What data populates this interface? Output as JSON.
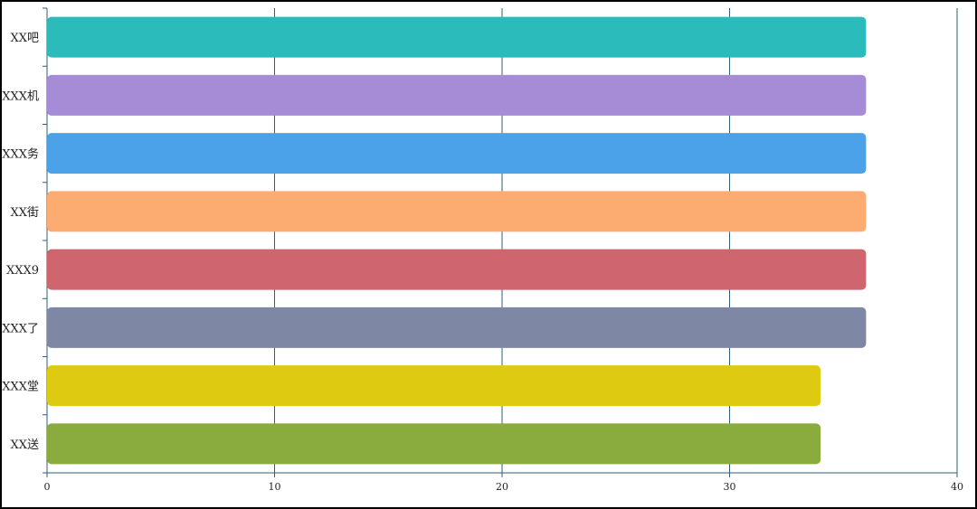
{
  "chart_data": {
    "type": "bar",
    "orientation": "horizontal",
    "categories": [
      "XX吧",
      "XXX机",
      "XXX务",
      "XX街",
      "XXX9",
      "XXX了",
      "XXX堂",
      "XX送"
    ],
    "values": [
      36,
      36,
      36,
      36,
      36,
      36,
      34,
      34
    ],
    "colors": [
      "#2bbbbb",
      "#a68bd7",
      "#4ba2e9",
      "#fcab71",
      "#cf666e",
      "#7e88a5",
      "#dfca12",
      "#8aab3e"
    ],
    "xlim": [
      0,
      40
    ],
    "xticks": [
      "0",
      "10",
      "20",
      "30",
      "40"
    ],
    "grid": true,
    "title": "",
    "xlabel": "",
    "ylabel": ""
  }
}
